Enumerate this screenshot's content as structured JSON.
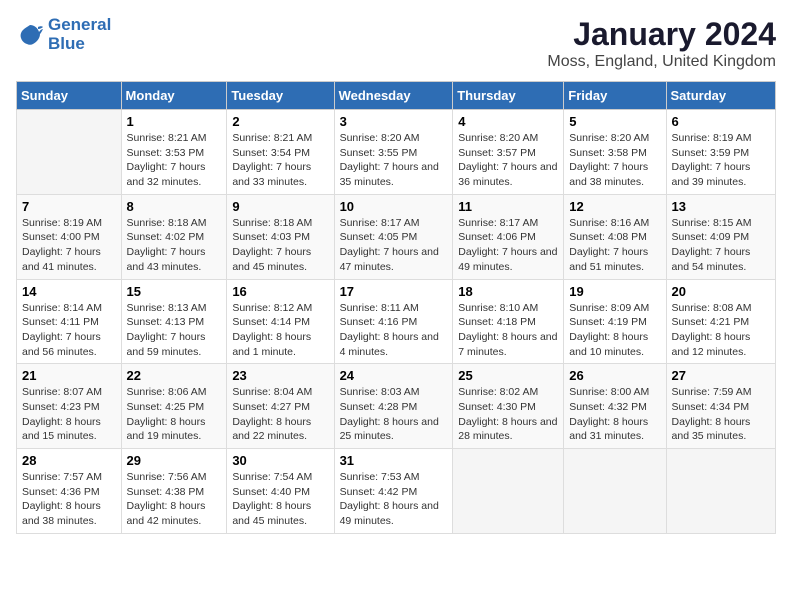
{
  "logo": {
    "line1": "General",
    "line2": "Blue"
  },
  "title": "January 2024",
  "subtitle": "Moss, England, United Kingdom",
  "weekdays": [
    "Sunday",
    "Monday",
    "Tuesday",
    "Wednesday",
    "Thursday",
    "Friday",
    "Saturday"
  ],
  "weeks": [
    [
      {
        "day": "",
        "sunrise": "",
        "sunset": "",
        "daylight": ""
      },
      {
        "day": "1",
        "sunrise": "Sunrise: 8:21 AM",
        "sunset": "Sunset: 3:53 PM",
        "daylight": "Daylight: 7 hours and 32 minutes."
      },
      {
        "day": "2",
        "sunrise": "Sunrise: 8:21 AM",
        "sunset": "Sunset: 3:54 PM",
        "daylight": "Daylight: 7 hours and 33 minutes."
      },
      {
        "day": "3",
        "sunrise": "Sunrise: 8:20 AM",
        "sunset": "Sunset: 3:55 PM",
        "daylight": "Daylight: 7 hours and 35 minutes."
      },
      {
        "day": "4",
        "sunrise": "Sunrise: 8:20 AM",
        "sunset": "Sunset: 3:57 PM",
        "daylight": "Daylight: 7 hours and 36 minutes."
      },
      {
        "day": "5",
        "sunrise": "Sunrise: 8:20 AM",
        "sunset": "Sunset: 3:58 PM",
        "daylight": "Daylight: 7 hours and 38 minutes."
      },
      {
        "day": "6",
        "sunrise": "Sunrise: 8:19 AM",
        "sunset": "Sunset: 3:59 PM",
        "daylight": "Daylight: 7 hours and 39 minutes."
      }
    ],
    [
      {
        "day": "7",
        "sunrise": "Sunrise: 8:19 AM",
        "sunset": "Sunset: 4:00 PM",
        "daylight": "Daylight: 7 hours and 41 minutes."
      },
      {
        "day": "8",
        "sunrise": "Sunrise: 8:18 AM",
        "sunset": "Sunset: 4:02 PM",
        "daylight": "Daylight: 7 hours and 43 minutes."
      },
      {
        "day": "9",
        "sunrise": "Sunrise: 8:18 AM",
        "sunset": "Sunset: 4:03 PM",
        "daylight": "Daylight: 7 hours and 45 minutes."
      },
      {
        "day": "10",
        "sunrise": "Sunrise: 8:17 AM",
        "sunset": "Sunset: 4:05 PM",
        "daylight": "Daylight: 7 hours and 47 minutes."
      },
      {
        "day": "11",
        "sunrise": "Sunrise: 8:17 AM",
        "sunset": "Sunset: 4:06 PM",
        "daylight": "Daylight: 7 hours and 49 minutes."
      },
      {
        "day": "12",
        "sunrise": "Sunrise: 8:16 AM",
        "sunset": "Sunset: 4:08 PM",
        "daylight": "Daylight: 7 hours and 51 minutes."
      },
      {
        "day": "13",
        "sunrise": "Sunrise: 8:15 AM",
        "sunset": "Sunset: 4:09 PM",
        "daylight": "Daylight: 7 hours and 54 minutes."
      }
    ],
    [
      {
        "day": "14",
        "sunrise": "Sunrise: 8:14 AM",
        "sunset": "Sunset: 4:11 PM",
        "daylight": "Daylight: 7 hours and 56 minutes."
      },
      {
        "day": "15",
        "sunrise": "Sunrise: 8:13 AM",
        "sunset": "Sunset: 4:13 PM",
        "daylight": "Daylight: 7 hours and 59 minutes."
      },
      {
        "day": "16",
        "sunrise": "Sunrise: 8:12 AM",
        "sunset": "Sunset: 4:14 PM",
        "daylight": "Daylight: 8 hours and 1 minute."
      },
      {
        "day": "17",
        "sunrise": "Sunrise: 8:11 AM",
        "sunset": "Sunset: 4:16 PM",
        "daylight": "Daylight: 8 hours and 4 minutes."
      },
      {
        "day": "18",
        "sunrise": "Sunrise: 8:10 AM",
        "sunset": "Sunset: 4:18 PM",
        "daylight": "Daylight: 8 hours and 7 minutes."
      },
      {
        "day": "19",
        "sunrise": "Sunrise: 8:09 AM",
        "sunset": "Sunset: 4:19 PM",
        "daylight": "Daylight: 8 hours and 10 minutes."
      },
      {
        "day": "20",
        "sunrise": "Sunrise: 8:08 AM",
        "sunset": "Sunset: 4:21 PM",
        "daylight": "Daylight: 8 hours and 12 minutes."
      }
    ],
    [
      {
        "day": "21",
        "sunrise": "Sunrise: 8:07 AM",
        "sunset": "Sunset: 4:23 PM",
        "daylight": "Daylight: 8 hours and 15 minutes."
      },
      {
        "day": "22",
        "sunrise": "Sunrise: 8:06 AM",
        "sunset": "Sunset: 4:25 PM",
        "daylight": "Daylight: 8 hours and 19 minutes."
      },
      {
        "day": "23",
        "sunrise": "Sunrise: 8:04 AM",
        "sunset": "Sunset: 4:27 PM",
        "daylight": "Daylight: 8 hours and 22 minutes."
      },
      {
        "day": "24",
        "sunrise": "Sunrise: 8:03 AM",
        "sunset": "Sunset: 4:28 PM",
        "daylight": "Daylight: 8 hours and 25 minutes."
      },
      {
        "day": "25",
        "sunrise": "Sunrise: 8:02 AM",
        "sunset": "Sunset: 4:30 PM",
        "daylight": "Daylight: 8 hours and 28 minutes."
      },
      {
        "day": "26",
        "sunrise": "Sunrise: 8:00 AM",
        "sunset": "Sunset: 4:32 PM",
        "daylight": "Daylight: 8 hours and 31 minutes."
      },
      {
        "day": "27",
        "sunrise": "Sunrise: 7:59 AM",
        "sunset": "Sunset: 4:34 PM",
        "daylight": "Daylight: 8 hours and 35 minutes."
      }
    ],
    [
      {
        "day": "28",
        "sunrise": "Sunrise: 7:57 AM",
        "sunset": "Sunset: 4:36 PM",
        "daylight": "Daylight: 8 hours and 38 minutes."
      },
      {
        "day": "29",
        "sunrise": "Sunrise: 7:56 AM",
        "sunset": "Sunset: 4:38 PM",
        "daylight": "Daylight: 8 hours and 42 minutes."
      },
      {
        "day": "30",
        "sunrise": "Sunrise: 7:54 AM",
        "sunset": "Sunset: 4:40 PM",
        "daylight": "Daylight: 8 hours and 45 minutes."
      },
      {
        "day": "31",
        "sunrise": "Sunrise: 7:53 AM",
        "sunset": "Sunset: 4:42 PM",
        "daylight": "Daylight: 8 hours and 49 minutes."
      },
      {
        "day": "",
        "sunrise": "",
        "sunset": "",
        "daylight": ""
      },
      {
        "day": "",
        "sunrise": "",
        "sunset": "",
        "daylight": ""
      },
      {
        "day": "",
        "sunrise": "",
        "sunset": "",
        "daylight": ""
      }
    ]
  ]
}
